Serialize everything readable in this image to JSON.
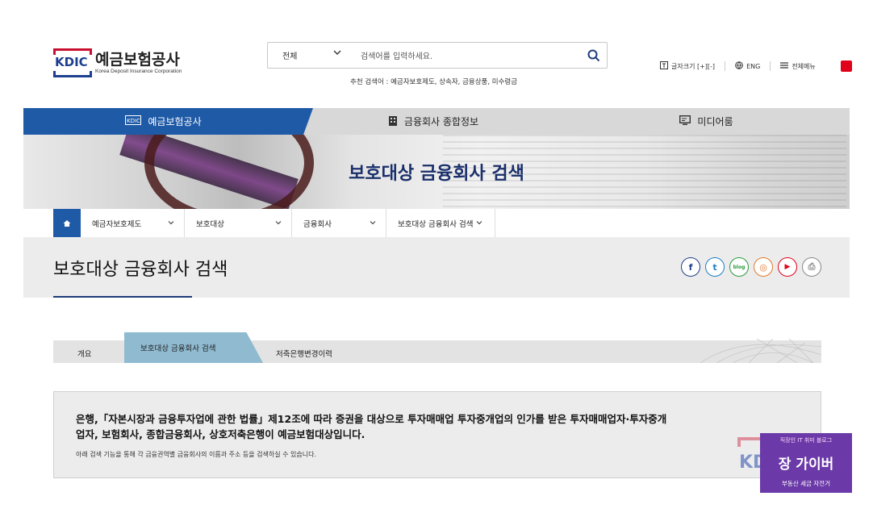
{
  "header": {
    "logo_mark": "KDIC",
    "logo_name": "예금보험공사",
    "logo_sub": "Korea Deposit Insurance Corporation",
    "search": {
      "category": "전체",
      "placeholder": "검색어를 입력하세요.",
      "recommend": "추천 검색어 : 예금자보호제도, 상속자, 금융상품, 미수령금"
    },
    "utils": [
      {
        "label": "글자크기 [+][-]",
        "icon": "text-size-icon"
      },
      {
        "label": "ENG",
        "icon": "globe-icon"
      },
      {
        "label": "전체메뉴",
        "icon": "menu-icon"
      }
    ]
  },
  "main_tabs": [
    {
      "label": "예금보험공사",
      "icon": "kdic-icon",
      "active": true
    },
    {
      "label": "금융회사 종합정보",
      "icon": "building-icon",
      "active": false
    },
    {
      "label": "미디어룸",
      "icon": "media-icon",
      "active": false
    }
  ],
  "banner": {
    "title": "보호대상 금융회사 검색"
  },
  "breadcrumb": [
    "예금자보호제도",
    "보호대상",
    "금융회사",
    "보호대상 금융회사 검색"
  ],
  "page": {
    "title": "보호대상 금융회사 검색",
    "sns": [
      {
        "icon": "facebook-icon",
        "glyph": "f",
        "color": "#1f3f8a"
      },
      {
        "icon": "twitter-icon",
        "glyph": "t",
        "color": "#1d7fc8"
      },
      {
        "icon": "blog-icon",
        "glyph": "blog",
        "color": "#2b9a3a"
      },
      {
        "icon": "instagram-icon",
        "glyph": "◎",
        "color": "#e0782a"
      },
      {
        "icon": "youtube-icon",
        "glyph": "▶",
        "color": "#e0001a"
      },
      {
        "icon": "print-icon",
        "glyph": "⎙",
        "color": "#888888"
      }
    ]
  },
  "sub_tabs": [
    {
      "label": "개요",
      "active": false
    },
    {
      "label": "보호대상 금융회사 검색",
      "active": true
    },
    {
      "label": "저축은행변경이력",
      "active": false
    }
  ],
  "info": {
    "main": "은행,「자본시장과 금융투자업에 관한 법률」제12조에 따라 증권을 대상으로 투자매매업 투자중개업의 인가를 받은 투자매매업자·투자중개업자, 보험회사, 종합금융회사, 상호저축은행이 예금보험대상입니다.",
    "sub": "아래 검색 기능을 통해 각 금융권역별 금융회사의 이름과 주소 등을 검색하실 수 있습니다."
  },
  "watermark": {
    "top": "직장인 IT 취미 블로그",
    "main": "장 가이버",
    "bottom": "부동산 세금 자전거",
    "logo": "KDIC"
  },
  "colors": {
    "primary": "#1f5aa6",
    "navy": "#1a2f6b",
    "tab_active": "#8fbad0"
  }
}
